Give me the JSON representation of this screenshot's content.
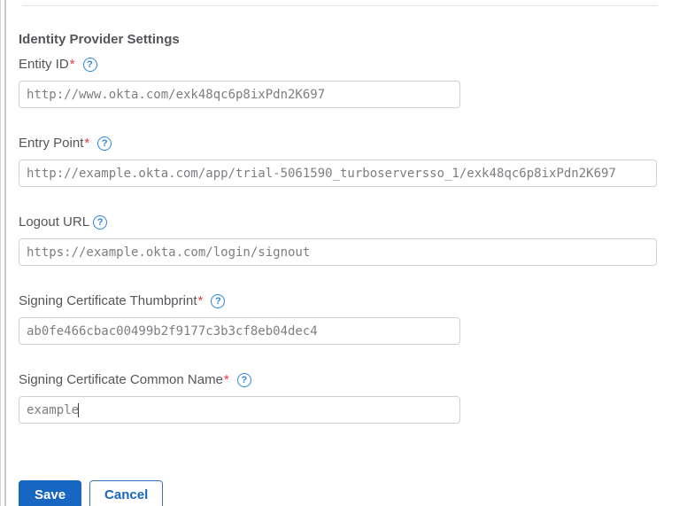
{
  "page": {
    "section_title": "Identity Provider Settings"
  },
  "form": {
    "help_glyph": "?",
    "fields": [
      {
        "label": "Entity ID",
        "required_mark": "*",
        "value": "http://www.okta.com/exk48qc6p8ixPdn2K697"
      },
      {
        "label": "Entry Point",
        "required_mark": "*",
        "value": "http://example.okta.com/app/trial-5061590_turboserversso_1/exk48qc6p8ixPdn2K697"
      },
      {
        "label": "Logout URL",
        "required_mark": "",
        "value": "https://example.okta.com/login/signout"
      },
      {
        "label": "Signing Certificate Thumbprint",
        "required_mark": "*",
        "value": "ab0fe466cbac00499b2f9177c3b3cf8eb04dec4"
      },
      {
        "label": "Signing Certificate Common Name",
        "required_mark": "*",
        "value": "example"
      }
    ]
  },
  "buttons": {
    "save_label": "Save",
    "cancel_label": "Cancel"
  },
  "colors": {
    "primary_blue": "#1766c2",
    "help_blue": "#2d85dd",
    "required_red": "#e03b3b",
    "label_gray": "#55565a",
    "input_text_gray": "#7c7e82",
    "input_border_gray": "#cfd0d2"
  }
}
